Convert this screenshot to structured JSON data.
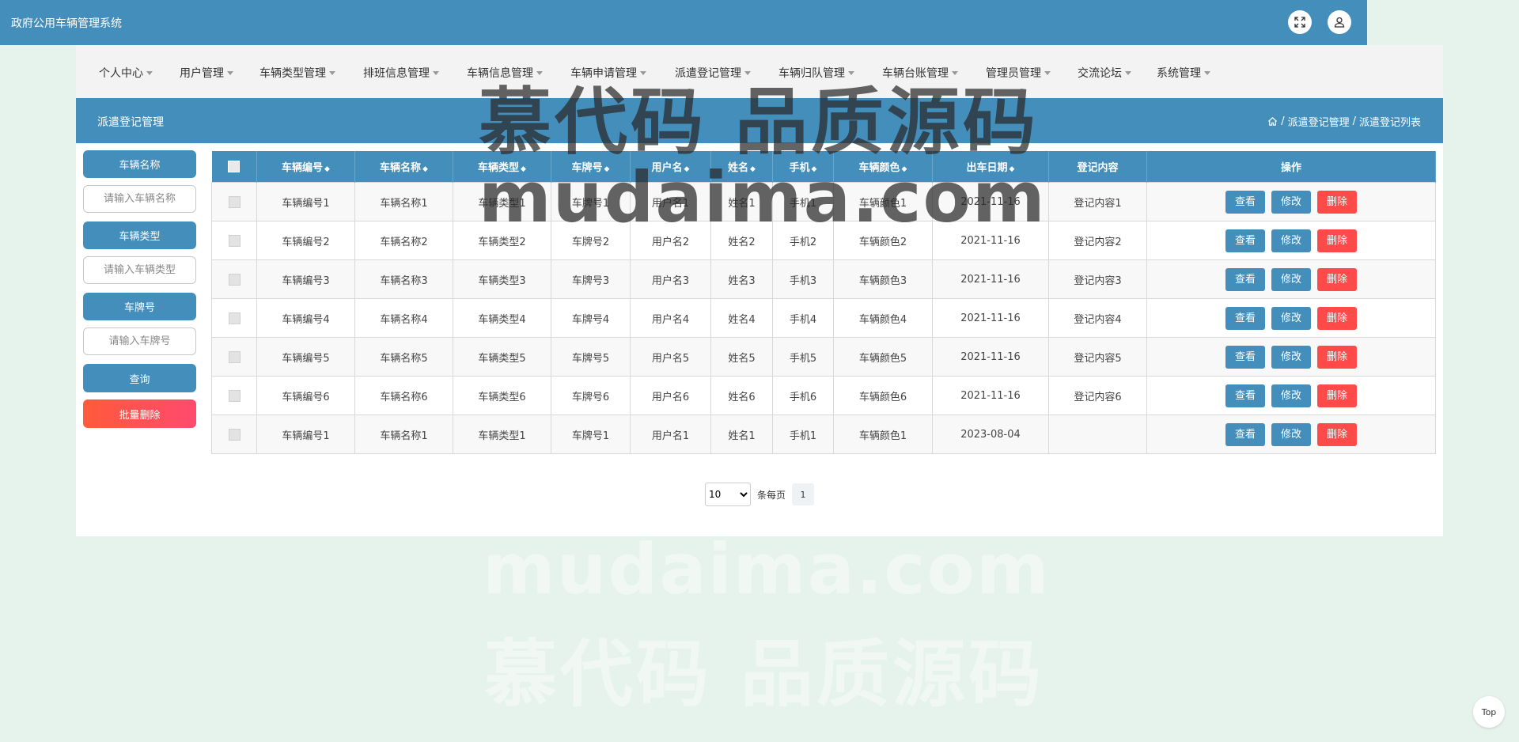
{
  "app": {
    "title": "政府公用车辆管理系统"
  },
  "nav": [
    {
      "label": "个人中心"
    },
    {
      "label": "用户管理"
    },
    {
      "label": "车辆类型管理"
    },
    {
      "label": "排班信息管理"
    },
    {
      "label": "车辆信息管理"
    },
    {
      "label": "车辆申请管理"
    },
    {
      "label": "派遣登记管理"
    },
    {
      "label": "车辆归队管理"
    },
    {
      "label": "车辆台账管理"
    },
    {
      "label": "管理员管理"
    },
    {
      "label": "交流论坛"
    },
    {
      "label": "系统管理"
    }
  ],
  "section": {
    "title": "派遣登记管理",
    "breadcrumb": [
      "派遣登记管理",
      "派遣登记列表"
    ],
    "breadcrumb_sep": "/"
  },
  "search": {
    "fields": [
      {
        "label": "车辆名称",
        "placeholder": "请输入车辆名称"
      },
      {
        "label": "车辆类型",
        "placeholder": "请输入车辆类型"
      },
      {
        "label": "车牌号",
        "placeholder": "请输入车牌号"
      }
    ],
    "query_label": "查询",
    "batch_delete_label": "批量删除"
  },
  "table": {
    "columns": [
      {
        "label": "车辆编号",
        "sortable": true
      },
      {
        "label": "车辆名称",
        "sortable": true
      },
      {
        "label": "车辆类型",
        "sortable": true
      },
      {
        "label": "车牌号",
        "sortable": true
      },
      {
        "label": "用户名",
        "sortable": true
      },
      {
        "label": "姓名",
        "sortable": true
      },
      {
        "label": "手机",
        "sortable": true
      },
      {
        "label": "车辆颜色",
        "sortable": true
      },
      {
        "label": "出车日期",
        "sortable": true
      },
      {
        "label": "登记内容",
        "sortable": false
      },
      {
        "label": "操作",
        "sortable": false
      }
    ],
    "sort_glyph": "◆",
    "rows": [
      [
        "车辆编号1",
        "车辆名称1",
        "车辆类型1",
        "车牌号1",
        "用户名1",
        "姓名1",
        "手机1",
        "车辆颜色1",
        "2021-11-16",
        "登记内容1"
      ],
      [
        "车辆编号2",
        "车辆名称2",
        "车辆类型2",
        "车牌号2",
        "用户名2",
        "姓名2",
        "手机2",
        "车辆颜色2",
        "2021-11-16",
        "登记内容2"
      ],
      [
        "车辆编号3",
        "车辆名称3",
        "车辆类型3",
        "车牌号3",
        "用户名3",
        "姓名3",
        "手机3",
        "车辆颜色3",
        "2021-11-16",
        "登记内容3"
      ],
      [
        "车辆编号4",
        "车辆名称4",
        "车辆类型4",
        "车牌号4",
        "用户名4",
        "姓名4",
        "手机4",
        "车辆颜色4",
        "2021-11-16",
        "登记内容4"
      ],
      [
        "车辆编号5",
        "车辆名称5",
        "车辆类型5",
        "车牌号5",
        "用户名5",
        "姓名5",
        "手机5",
        "车辆颜色5",
        "2021-11-16",
        "登记内容5"
      ],
      [
        "车辆编号6",
        "车辆名称6",
        "车辆类型6",
        "车牌号6",
        "用户名6",
        "姓名6",
        "手机6",
        "车辆颜色6",
        "2021-11-16",
        "登记内容6"
      ],
      [
        "车辆编号1",
        "车辆名称1",
        "车辆类型1",
        "车牌号1",
        "用户名1",
        "姓名1",
        "手机1",
        "车辆颜色1",
        "2023-08-04",
        ""
      ]
    ],
    "actions": {
      "view": "查看",
      "edit": "修改",
      "delete": "删除"
    }
  },
  "pagination": {
    "page_size": "10",
    "page_size_options": [
      "10"
    ],
    "per_page_label": "条每页",
    "current_page": "1"
  },
  "watermark": {
    "text_cn": "慕代码 品质源码",
    "text_en": "mudaima.com"
  },
  "back_to_top": "Top",
  "colors": {
    "primary": "#448ebc",
    "danger": "#ff4a4a",
    "background": "#e6f3ec",
    "navbar": "#f3f3f3"
  }
}
